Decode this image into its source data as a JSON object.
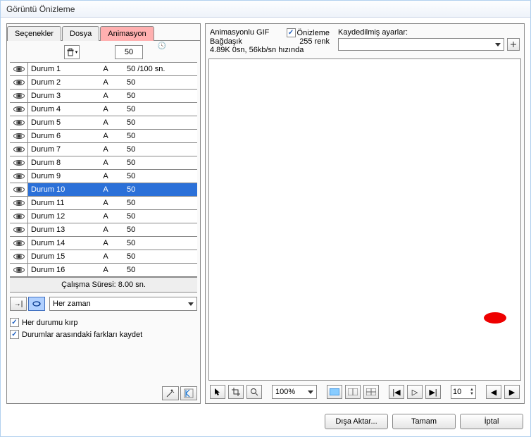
{
  "window": {
    "title": "Görüntü Önizleme"
  },
  "tabs": {
    "items": [
      "Seçenekler",
      "Dosya",
      "Animasyon"
    ],
    "active": 2
  },
  "toolbar": {
    "time_value": "50"
  },
  "frames": [
    {
      "name": "Durum 1",
      "type": "A",
      "val": "50 /100 sn."
    },
    {
      "name": "Durum 2",
      "type": "A",
      "val": "50"
    },
    {
      "name": "Durum 3",
      "type": "A",
      "val": "50"
    },
    {
      "name": "Durum 4",
      "type": "A",
      "val": "50"
    },
    {
      "name": "Durum 5",
      "type": "A",
      "val": "50"
    },
    {
      "name": "Durum 6",
      "type": "A",
      "val": "50"
    },
    {
      "name": "Durum 7",
      "type": "A",
      "val": "50"
    },
    {
      "name": "Durum 8",
      "type": "A",
      "val": "50"
    },
    {
      "name": "Durum 9",
      "type": "A",
      "val": "50"
    },
    {
      "name": "Durum 10",
      "type": "A",
      "val": "50"
    },
    {
      "name": "Durum 11",
      "type": "A",
      "val": "50"
    },
    {
      "name": "Durum 12",
      "type": "A",
      "val": "50"
    },
    {
      "name": "Durum 13",
      "type": "A",
      "val": "50"
    },
    {
      "name": "Durum 14",
      "type": "A",
      "val": "50"
    },
    {
      "name": "Durum 15",
      "type": "A",
      "val": "50"
    },
    {
      "name": "Durum 16",
      "type": "A",
      "val": "50"
    }
  ],
  "selected_frame": 9,
  "status": {
    "runtime_label": "Çalışma Süresi: 8.00 sn."
  },
  "loop": {
    "label": "Her zaman"
  },
  "checks": {
    "trim": "Her durumu kırp",
    "diff": "Durumlar arasındaki farkları kaydet"
  },
  "info": {
    "line1a": "Animasyonlu GIF",
    "line1b": "Önizleme",
    "line2a": "Bağdaşık",
    "line2b": "255 renk",
    "line3": "4.89K  0sn, 56kb/sn hızında",
    "saved_label": "Kaydedilmiş ayarlar:"
  },
  "controls": {
    "zoom": "100%",
    "frame_number": "10"
  },
  "footer": {
    "export": "Dışa Aktar...",
    "ok": "Tamam",
    "cancel": "İptal"
  }
}
